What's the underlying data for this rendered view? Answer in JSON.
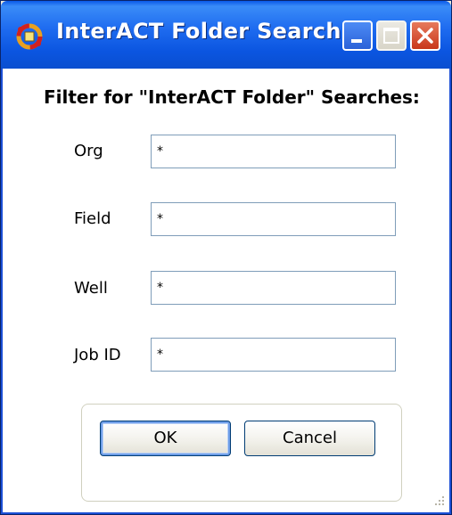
{
  "window": {
    "title": "InterACT Folder Search"
  },
  "dialog": {
    "heading": "Filter for \"InterACT Folder\" Searches:",
    "fields": [
      {
        "label": "Org",
        "value": "*"
      },
      {
        "label": "Field",
        "value": "*"
      },
      {
        "label": "Well",
        "value": "*"
      },
      {
        "label": "Job ID",
        "value": "*"
      }
    ],
    "ok_label": "OK",
    "cancel_label": "Cancel"
  },
  "icons": {
    "app": "interact-app-icon",
    "minimize": "minimize-icon",
    "maximize": "maximize-icon",
    "close": "close-icon",
    "grip": "resize-grip-icon"
  },
  "colors": {
    "titlebar": "#0b55e0",
    "close": "#c8361a",
    "input_border": "#7f9db9",
    "default_button_ring": "#6f9ee8"
  }
}
